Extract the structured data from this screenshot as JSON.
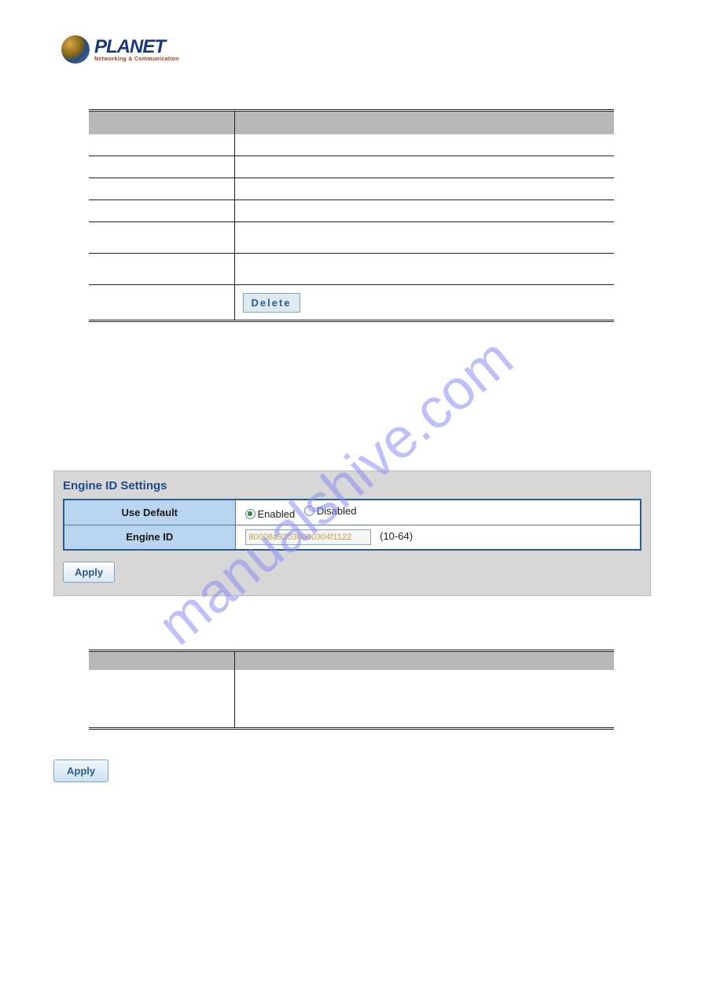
{
  "logo": {
    "brand": "PLANET",
    "tagline": "Networking & Communication"
  },
  "table1": {
    "delete_button_label": "Delete"
  },
  "panel": {
    "title": "Engine ID Settings",
    "use_default_label": "Use Default",
    "engine_id_label": "Engine ID",
    "radio_enabled": "Enabled",
    "radio_disabled": "Disabled",
    "engine_id_value": "80006a92030000304f1122",
    "engine_id_hint": "(10-64)",
    "apply_label": "Apply"
  },
  "apply_button": {
    "label": "Apply"
  }
}
